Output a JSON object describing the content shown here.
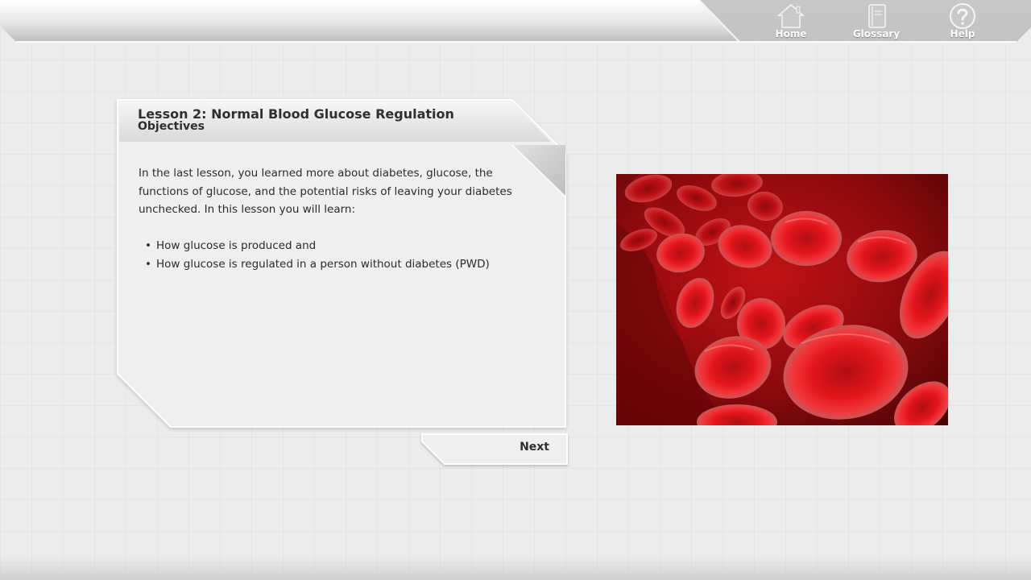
{
  "nav": {
    "items": [
      {
        "label": "Home",
        "icon": "home-icon"
      },
      {
        "label": "Glossary",
        "icon": "book-icon"
      },
      {
        "label": "Help",
        "icon": "question-icon"
      }
    ]
  },
  "lesson": {
    "title": "Lesson 2: Normal Blood Glucose Regulation",
    "subtitle": "Objectives",
    "intro": "In the last lesson, you learned more about diabetes, glucose, the functions of glucose, and the potential risks of leaving your diabetes unchecked. In this lesson you will learn:",
    "objectives": [
      "How glucose is produced and",
      "How glucose is regulated in a person without diabetes (PWD)"
    ]
  },
  "footer": {
    "next_label": "Next"
  },
  "colors": {
    "accent_red": "#c40f14",
    "panel": "#efefef",
    "bar": "#d6d6d6"
  }
}
